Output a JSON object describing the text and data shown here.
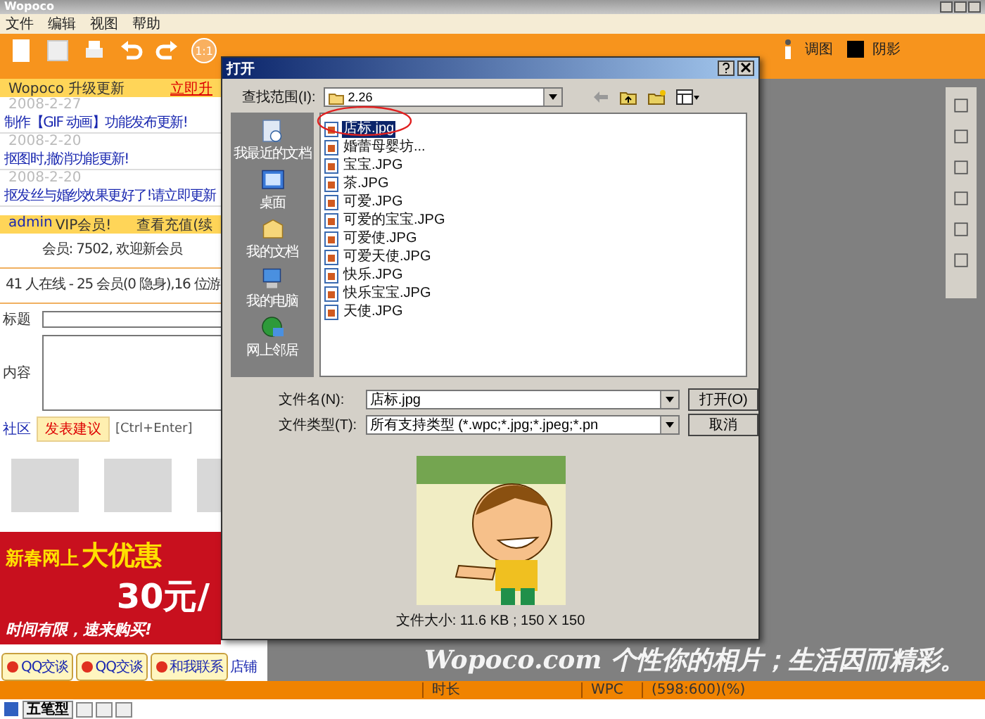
{
  "window": {
    "title": "Wopoco"
  },
  "menu": [
    "文件",
    "编辑",
    "视图",
    "帮助"
  ],
  "toolbar": {
    "zoom_label": "1:1",
    "labels": [
      "调图",
      "阴影"
    ]
  },
  "updates": {
    "title": "Wopoco 升级更新",
    "link": "立即升",
    "items": [
      {
        "date": "2008-2-27",
        "text": "制作【GIF 动画】功能发布更新!"
      },
      {
        "date": "2008-2-20",
        "text": "抠图时,撤消功能更新!"
      },
      {
        "date": "2008-2-20",
        "text": "抠发丝与婚纱效果更好了!请立即更新"
      }
    ]
  },
  "member_bar": {
    "user": "admin",
    "badge": "VIP会员!",
    "link": "查看充值(续"
  },
  "member_count": "会员: 7502, 欢迎新会员",
  "online": "41 人在线 - 25 会员(0 隐身),16 位游",
  "form": {
    "title_label": "标题",
    "content_label": "内容",
    "community_link": "社区",
    "submit": "发表建议",
    "hint": "[Ctrl+Enter]"
  },
  "ad": {
    "headline_small": "新春网上",
    "headline_big": "大优惠",
    "price": "30元/",
    "footer": "时间有限，速来购买!"
  },
  "contact_buttons": [
    "QQ交谈",
    "QQ交谈",
    "和我联系"
  ],
  "shop_link": "店铺",
  "slogan": "Wopoco.com 个性你的相片；生活因而精彩。",
  "status_bar": [
    "时长",
    "WPC",
    "(598:600)(%)"
  ],
  "ime": {
    "mode": "五笔型"
  },
  "dialog": {
    "title": "打开",
    "look_in_label": "查找范围(I):",
    "folder": "2.26",
    "places": [
      "我最近的文档",
      "桌面",
      "我的文档",
      "我的电脑",
      "网上邻居"
    ],
    "files": [
      {
        "name": "店标.jpg",
        "selected": true
      },
      {
        "name": "婚蕾母婴坊...",
        "selected": false
      },
      {
        "name": "宝宝.JPG",
        "selected": false
      },
      {
        "name": "茶.JPG",
        "selected": false
      },
      {
        "name": "可爱.JPG",
        "selected": false
      },
      {
        "name": "可爱的宝宝.JPG",
        "selected": false
      },
      {
        "name": "可爱使.JPG",
        "selected": false
      },
      {
        "name": "可爱天使.JPG",
        "selected": false
      },
      {
        "name": "快乐.JPG",
        "selected": false
      },
      {
        "name": "快乐宝宝.JPG",
        "selected": false
      },
      {
        "name": "天使.JPG",
        "selected": false
      }
    ],
    "filename_label": "文件名(N):",
    "filename": "店标.jpg",
    "filetype_label": "文件类型(T):",
    "filetype": "所有支持类型 (*.wpc;*.jpg;*.jpeg;*.pn",
    "buttons": [
      "打开(O)",
      "取消"
    ],
    "file_size": "文件大小: 11.6 KB ; 150 X 150"
  }
}
